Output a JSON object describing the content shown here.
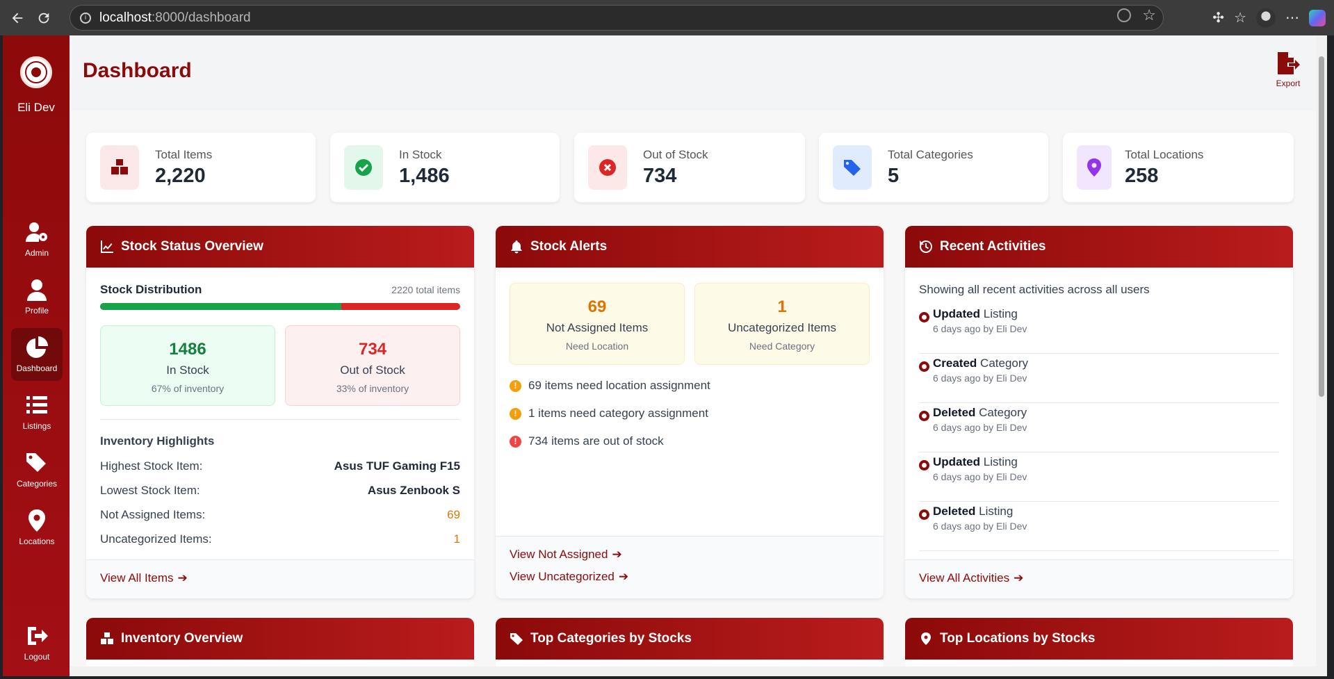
{
  "browser": {
    "url_host": "localhost",
    "url_path": ":8000/dashboard"
  },
  "sidebar": {
    "user_name": "Eli Dev",
    "items": [
      {
        "label": "Admin",
        "icon": "user-gear-icon"
      },
      {
        "label": "Profile",
        "icon": "user-icon"
      },
      {
        "label": "Dashboard",
        "icon": "pie-chart-icon",
        "active": true
      },
      {
        "label": "Listings",
        "icon": "list-icon"
      },
      {
        "label": "Categories",
        "icon": "tags-icon"
      },
      {
        "label": "Locations",
        "icon": "map-pin-icon"
      }
    ],
    "logout_label": "Logout"
  },
  "header": {
    "title": "Dashboard",
    "export_label": "Export"
  },
  "stats": [
    {
      "label": "Total Items",
      "value": "2,220",
      "icon": "boxes-icon",
      "color": "#8b0a0a",
      "bg": "#fbe9e9"
    },
    {
      "label": "In Stock",
      "value": "1,486",
      "icon": "check-circle-icon",
      "color": "#16a34a",
      "bg": "#e3f8ea"
    },
    {
      "label": "Out of Stock",
      "value": "734",
      "icon": "x-circle-icon",
      "color": "#dc2626",
      "bg": "#fde8e8"
    },
    {
      "label": "Total Categories",
      "value": "5",
      "icon": "tags-icon",
      "color": "#2563eb",
      "bg": "#e0ecfd"
    },
    {
      "label": "Total Locations",
      "value": "258",
      "icon": "map-pin-icon",
      "color": "#9333ea",
      "bg": "#f1e6fd"
    }
  ],
  "stock_status": {
    "title": "Stock Status Overview",
    "distribution_label": "Stock Distribution",
    "total_text": "2220 total items",
    "in_stock_fraction": 0.67,
    "in_stock": {
      "value": "1486",
      "label": "In Stock",
      "sub": "67% of inventory"
    },
    "out_of_stock": {
      "value": "734",
      "label": "Out of Stock",
      "sub": "33% of inventory"
    },
    "highlights_title": "Inventory Highlights",
    "highlights": [
      {
        "label": "Highest Stock Item:",
        "value": "Asus TUF Gaming F15"
      },
      {
        "label": "Lowest Stock Item:",
        "value": "Asus Zenbook S"
      },
      {
        "label": "Not Assigned Items:",
        "value": "69"
      },
      {
        "label": "Uncategorized Items:",
        "value": "1"
      }
    ],
    "footer_link": "View All Items"
  },
  "stock_alerts": {
    "title": "Stock Alerts",
    "boxes": [
      {
        "value": "69",
        "label": "Not Assigned Items",
        "sub": "Need Location"
      },
      {
        "value": "1",
        "label": "Uncategorized Items",
        "sub": "Need Category"
      }
    ],
    "lines": [
      {
        "text": "69 items need location assignment",
        "color": "#f59e0b"
      },
      {
        "text": "1 items need category assignment",
        "color": "#f59e0b"
      },
      {
        "text": "734 items are out of stock",
        "color": "#ef4444"
      }
    ],
    "links": [
      "View Not Assigned",
      "View Uncategorized"
    ]
  },
  "recent_activities": {
    "title": "Recent Activities",
    "subtitle": "Showing all recent activities across all users",
    "items": [
      {
        "action": "Updated",
        "target": "Listing",
        "meta": "6 days ago by Eli Dev"
      },
      {
        "action": "Created",
        "target": "Category",
        "meta": "6 days ago by Eli Dev"
      },
      {
        "action": "Deleted",
        "target": "Category",
        "meta": "6 days ago by Eli Dev"
      },
      {
        "action": "Updated",
        "target": "Listing",
        "meta": "6 days ago by Eli Dev"
      },
      {
        "action": "Deleted",
        "target": "Listing",
        "meta": "6 days ago by Eli Dev"
      }
    ],
    "footer_link": "View All Activities"
  },
  "bottom_panels": [
    {
      "title": "Inventory Overview",
      "icon": "boxes-icon"
    },
    {
      "title": "Top Categories by Stocks",
      "icon": "tags-icon"
    },
    {
      "title": "Top Locations by Stocks",
      "icon": "map-pin-icon"
    }
  ]
}
